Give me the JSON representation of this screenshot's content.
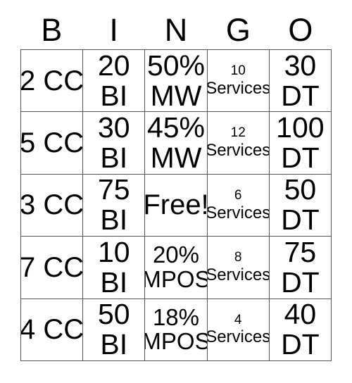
{
  "card": {
    "title": "BINGO",
    "header": [
      "B",
      "I",
      "N",
      "G",
      "O"
    ],
    "columns": [
      {
        "letter": "B",
        "cells": [
          {
            "top": "2 CC",
            "bottom": "",
            "size": "big",
            "single": true
          },
          {
            "top": "5 CC",
            "bottom": "",
            "size": "big",
            "single": true
          },
          {
            "top": "3 CC",
            "bottom": "",
            "size": "big",
            "single": true
          },
          {
            "top": "7 CC",
            "bottom": "",
            "size": "big",
            "single": true
          },
          {
            "top": "4 CC",
            "bottom": "",
            "size": "big",
            "single": true
          }
        ]
      },
      {
        "letter": "I",
        "cells": [
          {
            "top": "20",
            "bottom": "BI",
            "size": "big",
            "single": false
          },
          {
            "top": "30",
            "bottom": "BI",
            "size": "big",
            "single": false
          },
          {
            "top": "75",
            "bottom": "BI",
            "size": "big",
            "single": false
          },
          {
            "top": "10",
            "bottom": "BI",
            "size": "big",
            "single": false
          },
          {
            "top": "50",
            "bottom": "BI",
            "size": "big",
            "single": false
          }
        ]
      },
      {
        "letter": "N",
        "cells": [
          {
            "top": "50%",
            "bottom": "MW",
            "size": "big",
            "single": false
          },
          {
            "top": "45%",
            "bottom": "MW",
            "size": "big",
            "single": false
          },
          {
            "top": "Free!",
            "bottom": "",
            "size": "free",
            "single": true
          },
          {
            "top": "20%",
            "bottom": "MPOS",
            "size": "med",
            "single": false
          },
          {
            "top": "18%",
            "bottom": "MPOS",
            "size": "med",
            "single": false
          }
        ]
      },
      {
        "letter": "G",
        "cells": [
          {
            "top": "10",
            "bottom": "Services",
            "size": "tiny",
            "single": false
          },
          {
            "top": "12",
            "bottom": "Services",
            "size": "tiny",
            "single": false
          },
          {
            "top": "6",
            "bottom": "Services",
            "size": "tiny",
            "single": false
          },
          {
            "top": "8",
            "bottom": "Services",
            "size": "tiny",
            "single": false
          },
          {
            "top": "4",
            "bottom": "Services",
            "size": "tiny",
            "single": false
          }
        ]
      },
      {
        "letter": "O",
        "cells": [
          {
            "top": "30",
            "bottom": "DT",
            "size": "big",
            "single": false
          },
          {
            "top": "100",
            "bottom": "DT",
            "size": "big",
            "single": false
          },
          {
            "top": "50",
            "bottom": "DT",
            "size": "big",
            "single": false
          },
          {
            "top": "75",
            "bottom": "DT",
            "size": "big",
            "single": false
          },
          {
            "top": "40",
            "bottom": "DT",
            "size": "big",
            "single": false
          }
        ]
      }
    ],
    "colors": {
      "background": "#ffffff",
      "text": "#000000",
      "border": "#555555"
    }
  }
}
